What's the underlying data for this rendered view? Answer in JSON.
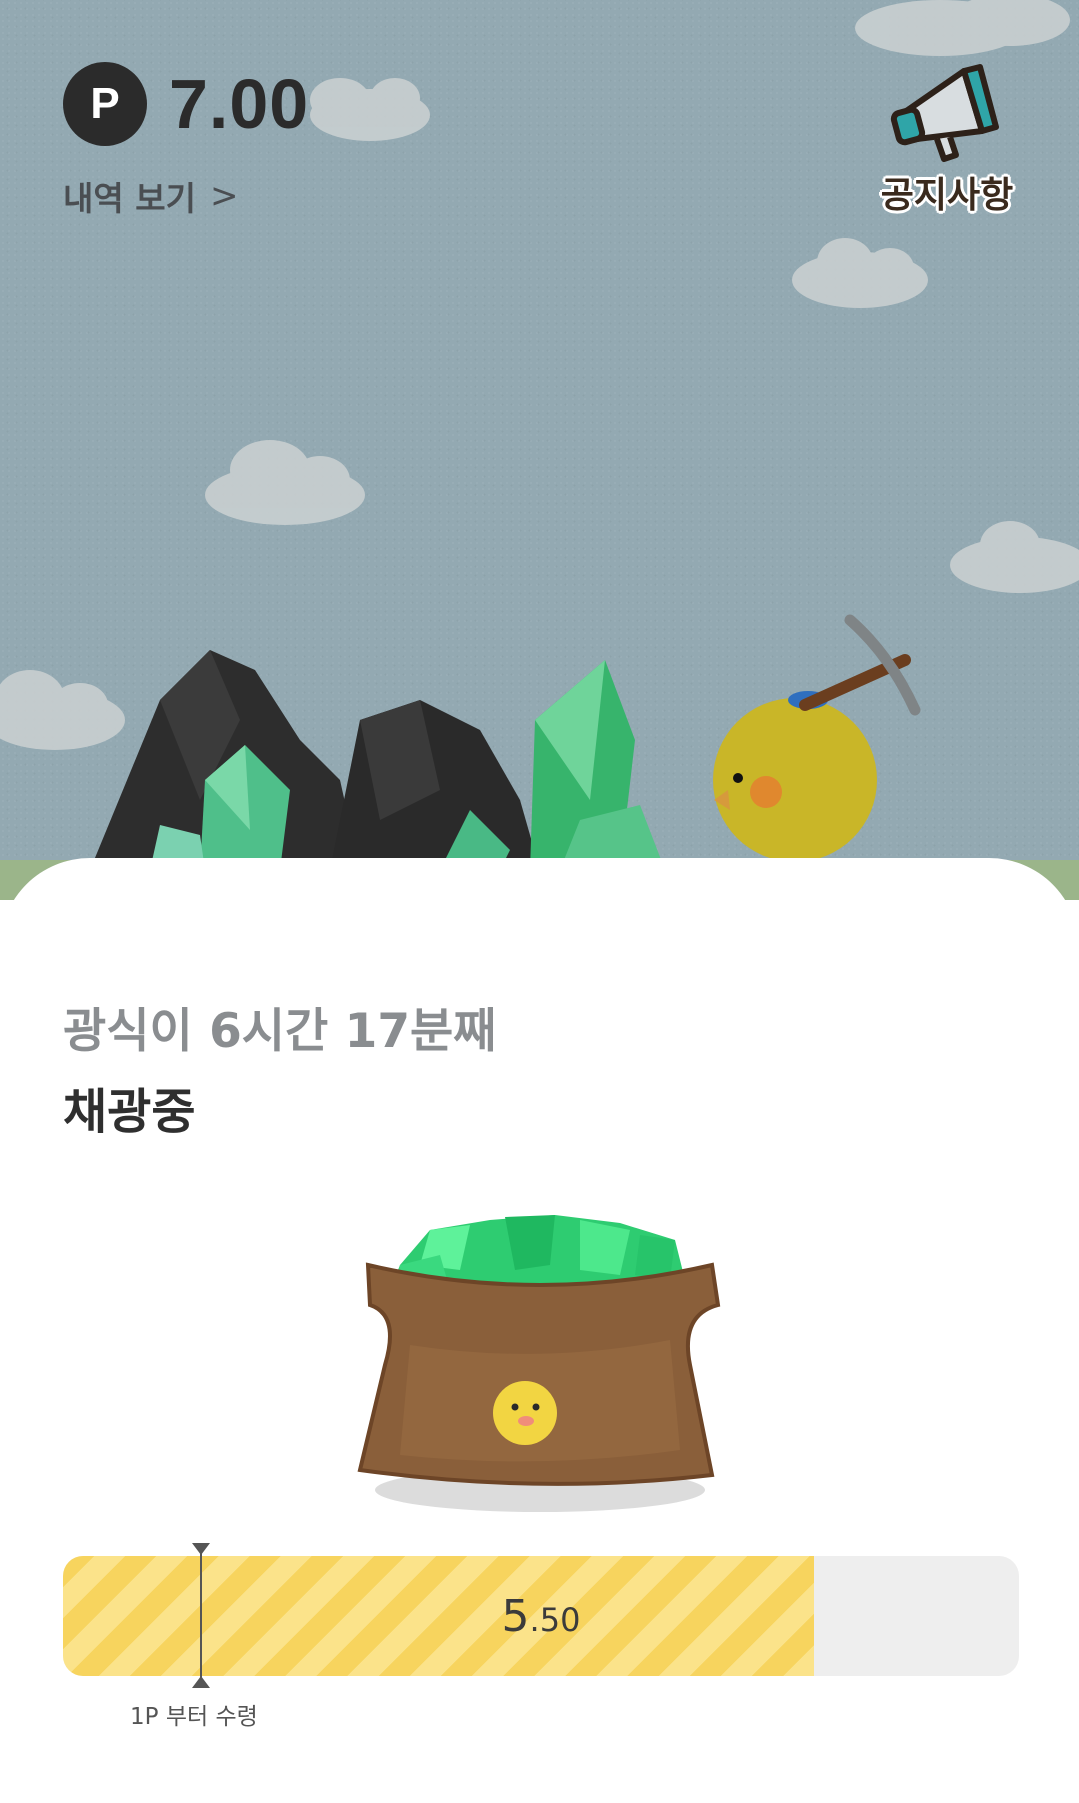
{
  "header": {
    "point_badge": "P",
    "point_value": "7.00",
    "history_link": "내역 보기",
    "notice_label": "공지사항"
  },
  "status": {
    "line1": "광식이 6시간 17분째",
    "line2": "채광중"
  },
  "progress": {
    "value_int": "5",
    "value_dec": ".50",
    "fill_fraction": 0.786,
    "min_marker_fraction": 0.143,
    "min_label": "1P 부터 수령"
  },
  "colors": {
    "sky": "#93a9b2",
    "bar_fill": "#f7d45e",
    "bar_track": "#eeeeee",
    "gem_green": "#2ecc71",
    "chick_yellow": "#c9b628"
  },
  "icons": [
    "megaphone-icon",
    "chevron-right-icon",
    "pickaxe-icon"
  ]
}
